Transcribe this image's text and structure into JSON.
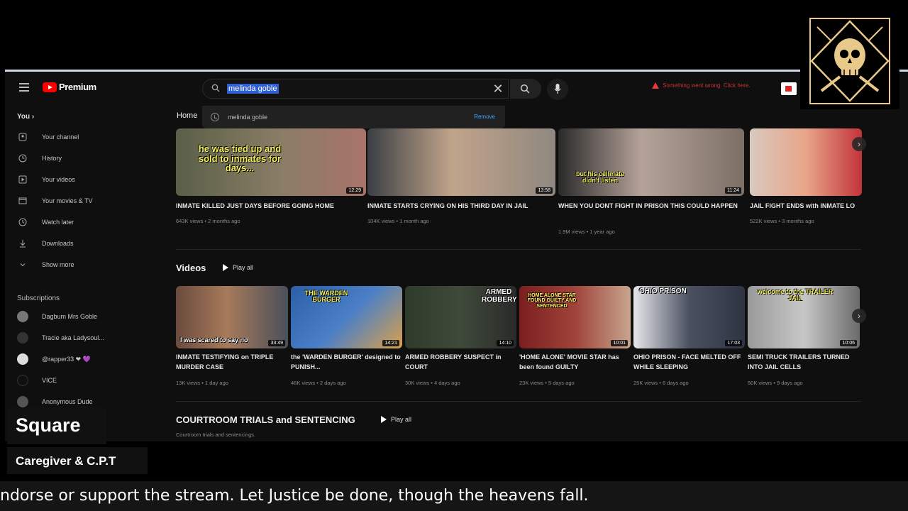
{
  "app": {
    "logo_text": "Premium"
  },
  "search": {
    "query": "melinda goble",
    "suggestion": "melinda goble",
    "suggestion_action": "Remove"
  },
  "alert": {
    "text": "Something went wrong. Click here."
  },
  "home_tab": "Home",
  "sidebar": {
    "you_label": "You",
    "items": [
      {
        "label": "Your channel",
        "icon": "channel-icon"
      },
      {
        "label": "History",
        "icon": "history-icon"
      },
      {
        "label": "Your videos",
        "icon": "video-icon"
      },
      {
        "label": "Your movies & TV",
        "icon": "movies-icon"
      },
      {
        "label": "Watch later",
        "icon": "clock-icon"
      },
      {
        "label": "Downloads",
        "icon": "download-icon"
      },
      {
        "label": "Show more",
        "icon": "chevron-down-icon"
      }
    ],
    "subscriptions_label": "Subscriptions",
    "subscriptions": [
      {
        "label": "Dagbum Mrs Goble",
        "color": "#777777"
      },
      {
        "label": "Tracie aka Ladysoul...",
        "color": "#333333"
      },
      {
        "label": "@rapper33 ❤ 💜",
        "color": "#dddddd"
      },
      {
        "label": "VICE",
        "color": "#111111"
      },
      {
        "label": "Anonymous Dude",
        "color": "#555555"
      }
    ]
  },
  "shelf_top": [
    {
      "title": "INMATE KILLED JUST DAYS BEFORE GOING HOME",
      "meta": "643K views • 2 months ago",
      "duration": "12:29",
      "caption": "he was tied up and sold to inmates for days..."
    },
    {
      "title": "INMATE STARTS CRYING ON HIS THIRD DAY IN JAIL",
      "meta": "104K views • 1 month ago",
      "duration": "13:58",
      "caption": ""
    },
    {
      "title": "WHEN YOU DONT FIGHT IN PRISON THIS COULD HAPPEN",
      "meta": "1.9M views • 1 year ago",
      "duration": "11:24",
      "caption": "but his cellmate didn't listen"
    },
    {
      "title": "JAIL FIGHT ENDS with INMATE LO",
      "meta": "522K views • 3 months ago",
      "duration": "",
      "caption": ""
    }
  ],
  "videos_section": {
    "title": "Videos",
    "play_all": "Play all",
    "items": [
      {
        "title": "INMATE TESTIFYING on TRIPLE MURDER CASE",
        "meta": "13K views • 1 day ago",
        "duration": "33:49",
        "caption": "I was scared to say no"
      },
      {
        "title": "the 'WARDEN BURGER' designed to PUNISH...",
        "meta": "46K views • 2 days ago",
        "duration": "14:21",
        "caption": "THE WARDEN BURGER"
      },
      {
        "title": "ARMED ROBBERY SUSPECT in COURT",
        "meta": "30K views • 4 days ago",
        "duration": "14:10",
        "caption": "ARMED ROBBERY"
      },
      {
        "title": "'HOME ALONE' MOVIE STAR has been found GUILTY",
        "meta": "23K views • 5 days ago",
        "duration": "10:01",
        "caption": "HOME ALONE STAR FOUND GUILTY AND SENTENCED"
      },
      {
        "title": "OHIO PRISON - FACE MELTED OFF WHILE SLEEPING",
        "meta": "25K views • 6 days ago",
        "duration": "17:03",
        "caption": "OHIO PRISON"
      },
      {
        "title": "SEMI TRUCK TRAILERS TURNED INTO JAIL CELLS",
        "meta": "50K views • 9 days ago",
        "duration": "10:06",
        "caption": "welcome to the TRAILER JAIL"
      }
    ]
  },
  "courtroom_section": {
    "title": "COURTROOM TRIALS and SENTENCING",
    "play_all": "Play all",
    "subtitle": "Courtroom trials and sentencings."
  },
  "overlay": {
    "name": "Square",
    "role": "Caregiver & C.P.T",
    "ticker": "ndorse or support the stream. Let Justice be done, though the heavens fall."
  }
}
